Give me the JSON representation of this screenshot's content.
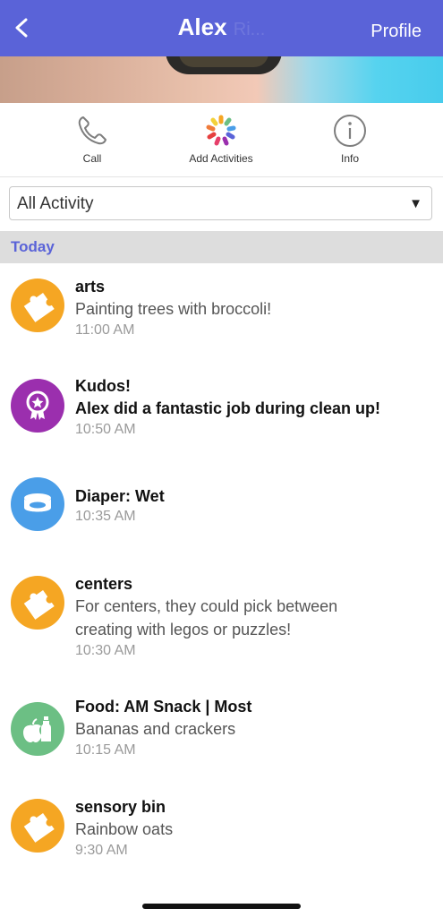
{
  "header": {
    "title": "Alex",
    "title_ghost": "Ri...",
    "profile_label": "Profile",
    "bg_color": "#5a63d8"
  },
  "actions": [
    {
      "label": "Call",
      "icon": "phone-icon"
    },
    {
      "label": "Add Activities",
      "icon": "color-wheel-icon"
    },
    {
      "label": "Info",
      "icon": "info-icon"
    }
  ],
  "filter": {
    "selected": "All Activity"
  },
  "section": {
    "label": "Today"
  },
  "activities": [
    {
      "title": "arts",
      "desc": "Painting trees with broccoli!",
      "time": "11:00 AM",
      "icon": "puzzle-icon",
      "color": "#f5a623"
    },
    {
      "title": "Kudos!",
      "desc": "Alex did a fantastic job during clean up!",
      "time": "10:50 AM",
      "icon": "award-icon",
      "color": "#9b2fae"
    },
    {
      "title": "Diaper: Wet",
      "desc": "",
      "time": "10:35 AM",
      "icon": "diaper-icon",
      "color": "#4a9ee8"
    },
    {
      "title": "centers",
      "desc_line1": "For centers, they could pick between",
      "desc_line2": "creating with legos or puzzles!",
      "time": "10:30 AM",
      "icon": "puzzle-icon",
      "color": "#f5a623"
    },
    {
      "title": "Food: AM Snack | Most",
      "desc": "Bananas and crackers",
      "time": "10:15 AM",
      "icon": "food-icon",
      "color": "#6cbf84"
    },
    {
      "title": "sensory bin",
      "desc": "Rainbow oats",
      "time": "9:30 AM",
      "icon": "puzzle-icon",
      "color": "#f5a623"
    }
  ]
}
